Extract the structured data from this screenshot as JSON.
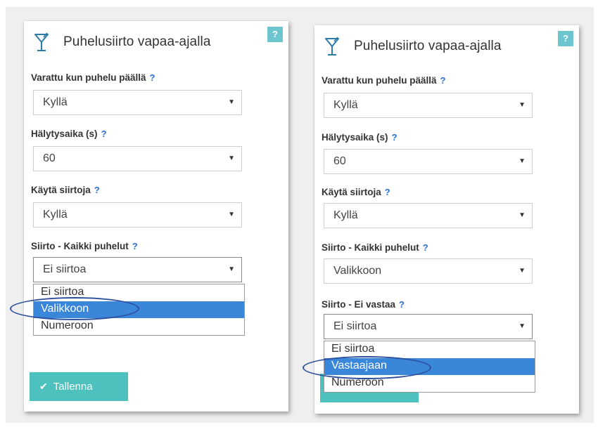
{
  "panels": [
    {
      "title": "Puhelusiirto vapaa-ajalla",
      "help_badge": "?",
      "fields": [
        {
          "label": "Varattu kun puhelu päällä",
          "help": "?",
          "value": "Kyllä"
        },
        {
          "label": "Hälytysaika (s)",
          "help": "?",
          "value": "60"
        },
        {
          "label": "Käytä siirtoja",
          "help": "?",
          "value": "Kyllä"
        },
        {
          "label": "Siirto - Kaikki puhelut",
          "help": "?",
          "value": "Ei siirtoa"
        }
      ],
      "dropdown_options": [
        "Ei siirtoa",
        "Valikkoon",
        "Numeroon"
      ],
      "dropdown_selected": "Valikkoon",
      "save_label": "Tallenna"
    },
    {
      "title": "Puhelusiirto vapaa-ajalla",
      "help_badge": "?",
      "fields": [
        {
          "label": "Varattu kun puhelu päällä",
          "help": "?",
          "value": "Kyllä"
        },
        {
          "label": "Hälytysaika (s)",
          "help": "?",
          "value": "60"
        },
        {
          "label": "Käytä siirtoja",
          "help": "?",
          "value": "Kyllä"
        },
        {
          "label": "Siirto - Kaikki puhelut",
          "help": "?",
          "value": "Valikkoon"
        },
        {
          "label": "Siirto - Ei vastaa",
          "help": "?",
          "value": "Ei siirtoa"
        }
      ],
      "dropdown_options": [
        "Ei siirtoa",
        "Vastaajaan",
        "Numeroon"
      ],
      "dropdown_selected": "Vastaajaan"
    }
  ],
  "colors": {
    "accent_teal": "#4cc1bd",
    "help_badge": "#6cc5cf",
    "selected_option": "#3a86d9",
    "help_mark": "#2a6fd6",
    "highlight_ellipse": "#2d4f9e"
  },
  "icons": {
    "header": "cocktail-glass-icon",
    "save": "checkmark-icon",
    "select": "dropdown-arrow-icon"
  }
}
